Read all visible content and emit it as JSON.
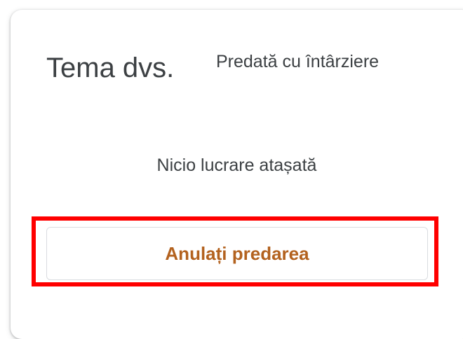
{
  "card": {
    "title": "Tema dvs.",
    "status": "Predată cu întârziere",
    "empty_message": "Nicio lucrare atașată",
    "unsubmit_label": "Anulați predarea"
  },
  "colors": {
    "accent": "#b3621f",
    "highlight": "#ff0000",
    "text": "#3c4043"
  }
}
